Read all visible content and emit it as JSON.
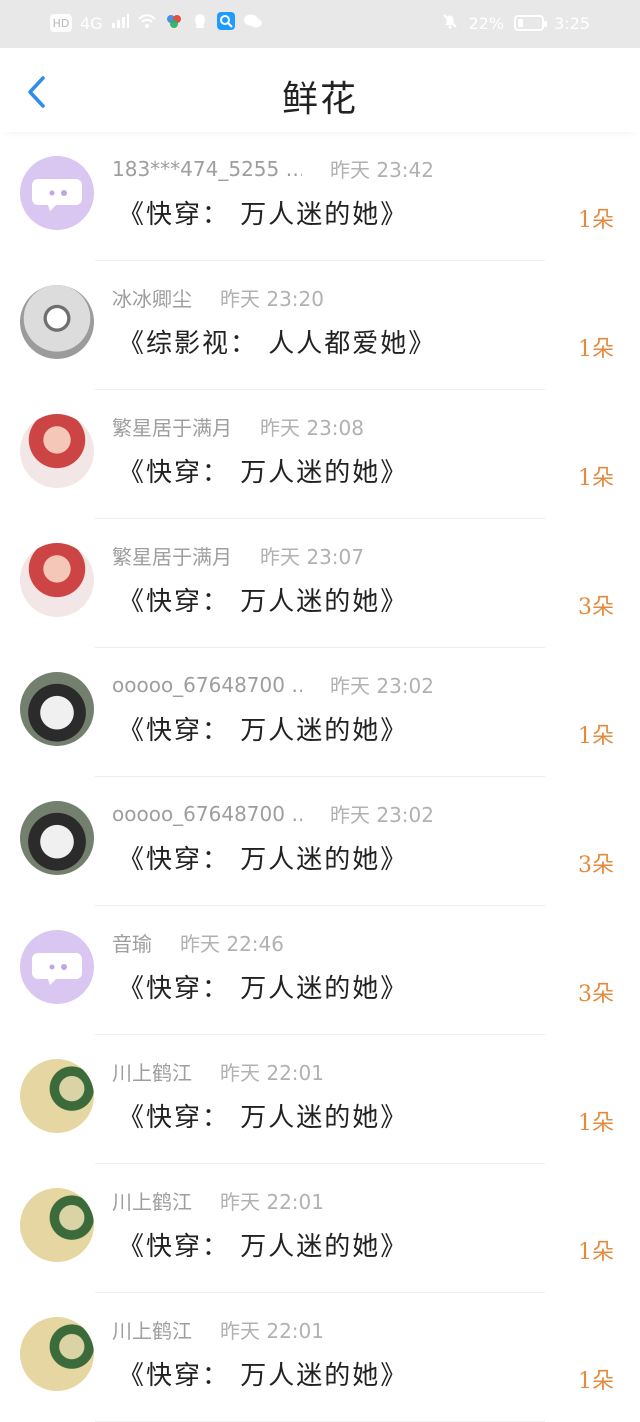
{
  "status_bar": {
    "left_icons": [
      "HD",
      "4G",
      "signal-icon",
      "wifi-icon",
      "app-icon",
      "qq-icon",
      "search-app-icon",
      "wechat-icon"
    ],
    "battery_percent": "22%",
    "time": "3:25",
    "battery_level": 0.22
  },
  "header": {
    "title": "鲜花",
    "back_icon": "chevron-left-icon",
    "accent_color": "#2d8cf0"
  },
  "list": {
    "items": [
      {
        "name": "183***474_5255 …",
        "time": "昨天 23:42",
        "book": "《快穿：  万人迷的她》",
        "count": "1朵",
        "avatar": "purple-chat"
      },
      {
        "name": "冰冰卿尘",
        "time": "昨天 23:20",
        "book": "《综影视：  人人都爱她》",
        "count": "1朵",
        "avatar": "sketch-eye"
      },
      {
        "name": "繁星居于满月",
        "time": "昨天 23:08",
        "book": "《快穿：  万人迷的她》",
        "count": "1朵",
        "avatar": "anime-girl"
      },
      {
        "name": "繁星居于满月",
        "time": "昨天 23:07",
        "book": "《快穿：  万人迷的她》",
        "count": "3朵",
        "avatar": "anime-girl"
      },
      {
        "name": "ooooo_67648700 …",
        "time": "昨天 23:02",
        "book": "《快穿：  万人迷的她》",
        "count": "1朵",
        "avatar": "panda"
      },
      {
        "name": "ooooo_67648700 …",
        "time": "昨天 23:02",
        "book": "《快穿：  万人迷的她》",
        "count": "3朵",
        "avatar": "panda"
      },
      {
        "name": "音瑜",
        "time": "昨天 22:46",
        "book": "《快穿：  万人迷的她》",
        "count": "3朵",
        "avatar": "purple-chat"
      },
      {
        "name": "川上鹤江",
        "time": "昨天 22:01",
        "book": "《快穿：  万人迷的她》",
        "count": "1朵",
        "avatar": "prince"
      },
      {
        "name": "川上鹤江",
        "time": "昨天 22:01",
        "book": "《快穿：  万人迷的她》",
        "count": "1朵",
        "avatar": "prince"
      },
      {
        "name": "川上鹤江",
        "time": "昨天 22:01",
        "book": "《快穿：  万人迷的她》",
        "count": "1朵",
        "avatar": "prince"
      }
    ]
  },
  "colors": {
    "count": "#e38a3d",
    "meta": "#9e9e9e"
  }
}
